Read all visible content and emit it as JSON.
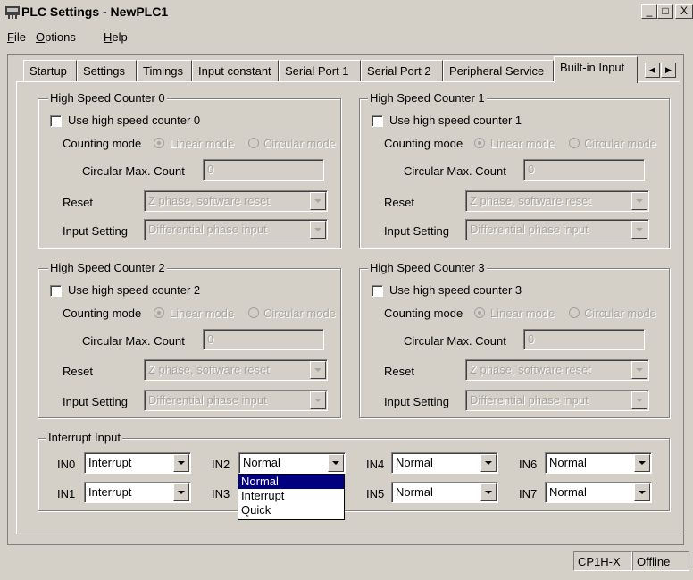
{
  "window": {
    "title": "PLC Settings - NewPLC1",
    "minimize": "_",
    "maximize": "□",
    "close": "X"
  },
  "menu": [
    {
      "key": "F",
      "rest": "ile"
    },
    {
      "key": "O",
      "rest": "ptions"
    },
    {
      "key": "H",
      "rest": "elp"
    }
  ],
  "tabs": [
    "Startup",
    "Settings",
    "Timings",
    "Input constant",
    "Serial Port 1",
    "Serial Port 2",
    "Peripheral Service",
    "Built-in Input"
  ],
  "active_tab": "Built-in Input",
  "tab_scroll": {
    "left": "◀",
    "right": "▶"
  },
  "counters": [
    {
      "title": "High Speed Counter 0",
      "use_label": "Use high speed counter 0",
      "counting_mode_label": "Counting mode",
      "linear": "Linear mode",
      "circular": "Circular mode",
      "max_label": "Circular Max. Count",
      "max_value": "0",
      "reset_label": "Reset",
      "reset_value": "Z phase, software reset",
      "input_label": "Input Setting",
      "input_value": "Differential phase input"
    },
    {
      "title": "High Speed Counter 1",
      "use_label": "Use high speed counter 1",
      "counting_mode_label": "Counting mode",
      "linear": "Linear mode",
      "circular": "Circular mode",
      "max_label": "Circular Max. Count",
      "max_value": "0",
      "reset_label": "Reset",
      "reset_value": "Z phase, software reset",
      "input_label": "Input Setting",
      "input_value": "Differential phase input"
    },
    {
      "title": "High Speed Counter 2",
      "use_label": "Use high speed counter 2",
      "counting_mode_label": "Counting mode",
      "linear": "Linear mode",
      "circular": "Circular mode",
      "max_label": "Circular Max. Count",
      "max_value": "0",
      "reset_label": "Reset",
      "reset_value": "Z phase, software reset",
      "input_label": "Input Setting",
      "input_value": "Differential phase input"
    },
    {
      "title": "High Speed Counter 3",
      "use_label": "Use high speed counter 3",
      "counting_mode_label": "Counting mode",
      "linear": "Linear mode",
      "circular": "Circular mode",
      "max_label": "Circular Max. Count",
      "max_value": "0",
      "reset_label": "Reset",
      "reset_value": "Z phase, software reset",
      "input_label": "Input Setting",
      "input_value": "Differential phase input"
    }
  ],
  "interrupt": {
    "title": "Interrupt Input",
    "inputs": [
      {
        "label": "IN0",
        "value": "Interrupt"
      },
      {
        "label": "IN1",
        "value": "Interrupt"
      },
      {
        "label": "IN2",
        "value": "Normal"
      },
      {
        "label": "IN3",
        "value": ""
      },
      {
        "label": "IN4",
        "value": "Normal"
      },
      {
        "label": "IN5",
        "value": "Normal"
      },
      {
        "label": "IN6",
        "value": "Normal"
      },
      {
        "label": "IN7",
        "value": "Normal"
      }
    ],
    "open_dropdown_options": [
      "Normal",
      "Interrupt",
      "Quick"
    ],
    "open_dropdown_selected": "Normal"
  },
  "status": {
    "model": "CP1H-X",
    "connection": "Offline"
  }
}
